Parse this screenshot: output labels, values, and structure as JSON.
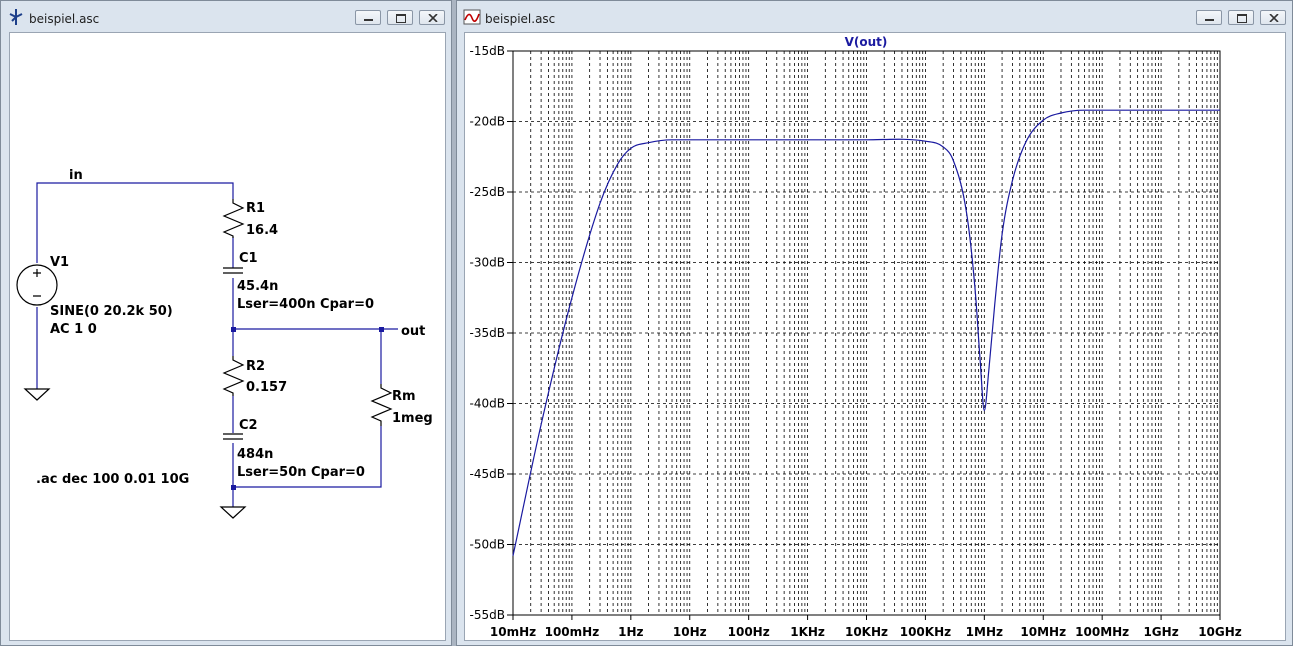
{
  "schematic_window": {
    "title": "beispiel.asc",
    "nets": {
      "input": "in",
      "output": "out"
    },
    "components": {
      "v1": {
        "name": "V1",
        "value": "SINE(0 20.2k 50)",
        "ac": "AC 1 0"
      },
      "r1": {
        "name": "R1",
        "value": "16.4"
      },
      "c1": {
        "name": "C1",
        "value": "45.4n",
        "params": "Lser=400n Cpar=0"
      },
      "r2": {
        "name": "R2",
        "value": "0.157"
      },
      "c2": {
        "name": "C2",
        "value": "484n",
        "params": "Lser=50n Cpar=0"
      },
      "rm": {
        "name": "Rm",
        "value": "1meg"
      }
    },
    "directive": ".ac dec 100 0.01 10G"
  },
  "plot_window": {
    "title": "beispiel.asc",
    "trace_color": "#1a1aa0",
    "chart_data": {
      "type": "line",
      "title": "V(out)",
      "x_scale": "log",
      "xlim": [
        0.01,
        10000000000
      ],
      "x_ticks": [
        0.01,
        0.1,
        1,
        10,
        100,
        1000,
        10000,
        100000,
        1000000,
        10000000,
        100000000,
        1000000000,
        10000000000
      ],
      "x_tick_labels": [
        "10mHz",
        "100mHz",
        "1Hz",
        "10Hz",
        "100Hz",
        "1KHz",
        "10KHz",
        "100KHz",
        "1MHz",
        "10MHz",
        "100MHz",
        "1GHz",
        "10GHz"
      ],
      "ylim": [
        -55,
        -15
      ],
      "y_ticks": [
        -15,
        -20,
        -25,
        -30,
        -35,
        -40,
        -45,
        -50,
        -55
      ],
      "y_tick_labels": [
        "-15dB",
        "-20dB",
        "-25dB",
        "-30dB",
        "-35dB",
        "-40dB",
        "-45dB",
        "-50dB",
        "-55dB"
      ],
      "grid": true,
      "series": [
        {
          "x": [
            0.01,
            0.03,
            0.1,
            0.3,
            0.6,
            1,
            2,
            5,
            10,
            100,
            1000,
            10000,
            100000,
            200000,
            300000,
            500000,
            700000,
            850000,
            1000000,
            1200000,
            1500000,
            2000000,
            3000000,
            5000000,
            10000000,
            20000000,
            50000000,
            100000000,
            1000000000,
            10000000000
          ],
          "y": [
            -50.8,
            -41.5,
            -32.5,
            -25.8,
            -23.0,
            -21.9,
            -21.5,
            -21.3,
            -21.3,
            -21.3,
            -21.3,
            -21.3,
            -21.4,
            -21.8,
            -22.8,
            -26.5,
            -32.0,
            -37.0,
            -40.5,
            -37.5,
            -33.0,
            -28.0,
            -24.2,
            -21.5,
            -19.9,
            -19.4,
            -19.2,
            -19.2,
            -19.2,
            -19.2
          ]
        }
      ]
    }
  }
}
